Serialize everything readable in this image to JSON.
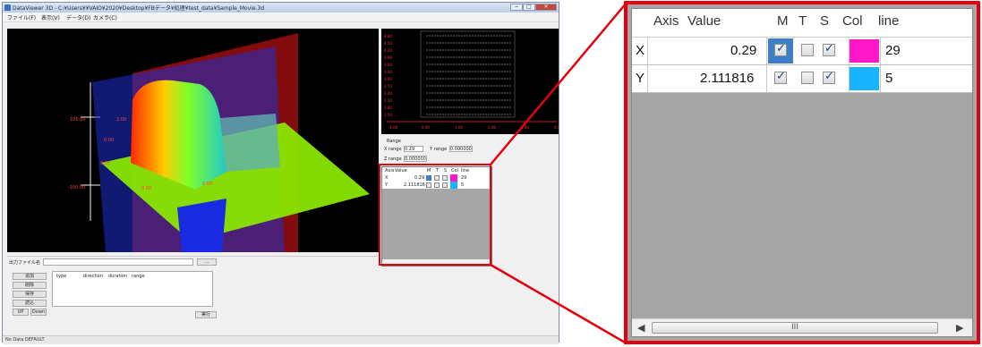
{
  "window": {
    "title": "DataViewer 3D - C:¥Users¥¥VAIO¥2020¥Desktop¥FBデータ¥処理¥test_data¥Sample_Movie.3d",
    "min": "−",
    "max": "□",
    "close": "✕"
  },
  "menu": [
    "ファイル(F)",
    "表示(V)",
    "データ(D)",
    "カメラ(C)"
  ],
  "viewport": {
    "labels": [
      "100.00",
      "2.00",
      "0.00",
      "0.00",
      "-100.00",
      "0.00",
      "0.00"
    ]
  },
  "preview": {
    "y_ticks": [
      "4.80",
      "4.50",
      "4.20",
      "3.90",
      "3.60",
      "3.30",
      "3.00",
      "2.70",
      "2.40",
      "2.10",
      "1.80",
      "1.50"
    ],
    "x_ticks": [
      "-1.00",
      "0.00",
      "1.00",
      "2.00",
      "3.00",
      "4.00"
    ]
  },
  "range_panel": {
    "group": "Range",
    "x_label": "X range",
    "x_value": "0.29",
    "y_label": "Y range",
    "y_value": "0.000000",
    "z_label": "Z range",
    "z_value": "0.000000"
  },
  "table": {
    "headers": {
      "axis": "Axis",
      "value": "Value",
      "m": "M",
      "t": "T",
      "s": "S",
      "col": "Col",
      "line": "line"
    },
    "rows": [
      {
        "axis": "X",
        "value": "0.29",
        "m": true,
        "t": false,
        "s": true,
        "color": "#ff18c8",
        "line": "29"
      },
      {
        "axis": "Y",
        "value": "2.111816",
        "m": true,
        "t": false,
        "s": true,
        "color": "#18b4ff",
        "line": "5"
      }
    ],
    "scroll_left": "◀",
    "scroll_right": "▶",
    "scroll_grip": "III"
  },
  "bottom": {
    "file_label": "出力ファイル名",
    "browse": "...",
    "buttons": [
      "追加",
      "削除",
      "保存",
      "読込"
    ],
    "col_headers": [
      "type",
      "direction",
      "duration",
      "range"
    ],
    "small_a": "UP",
    "small_b": "Down",
    "run": "実行"
  },
  "status": "No Data  DEFAULT"
}
